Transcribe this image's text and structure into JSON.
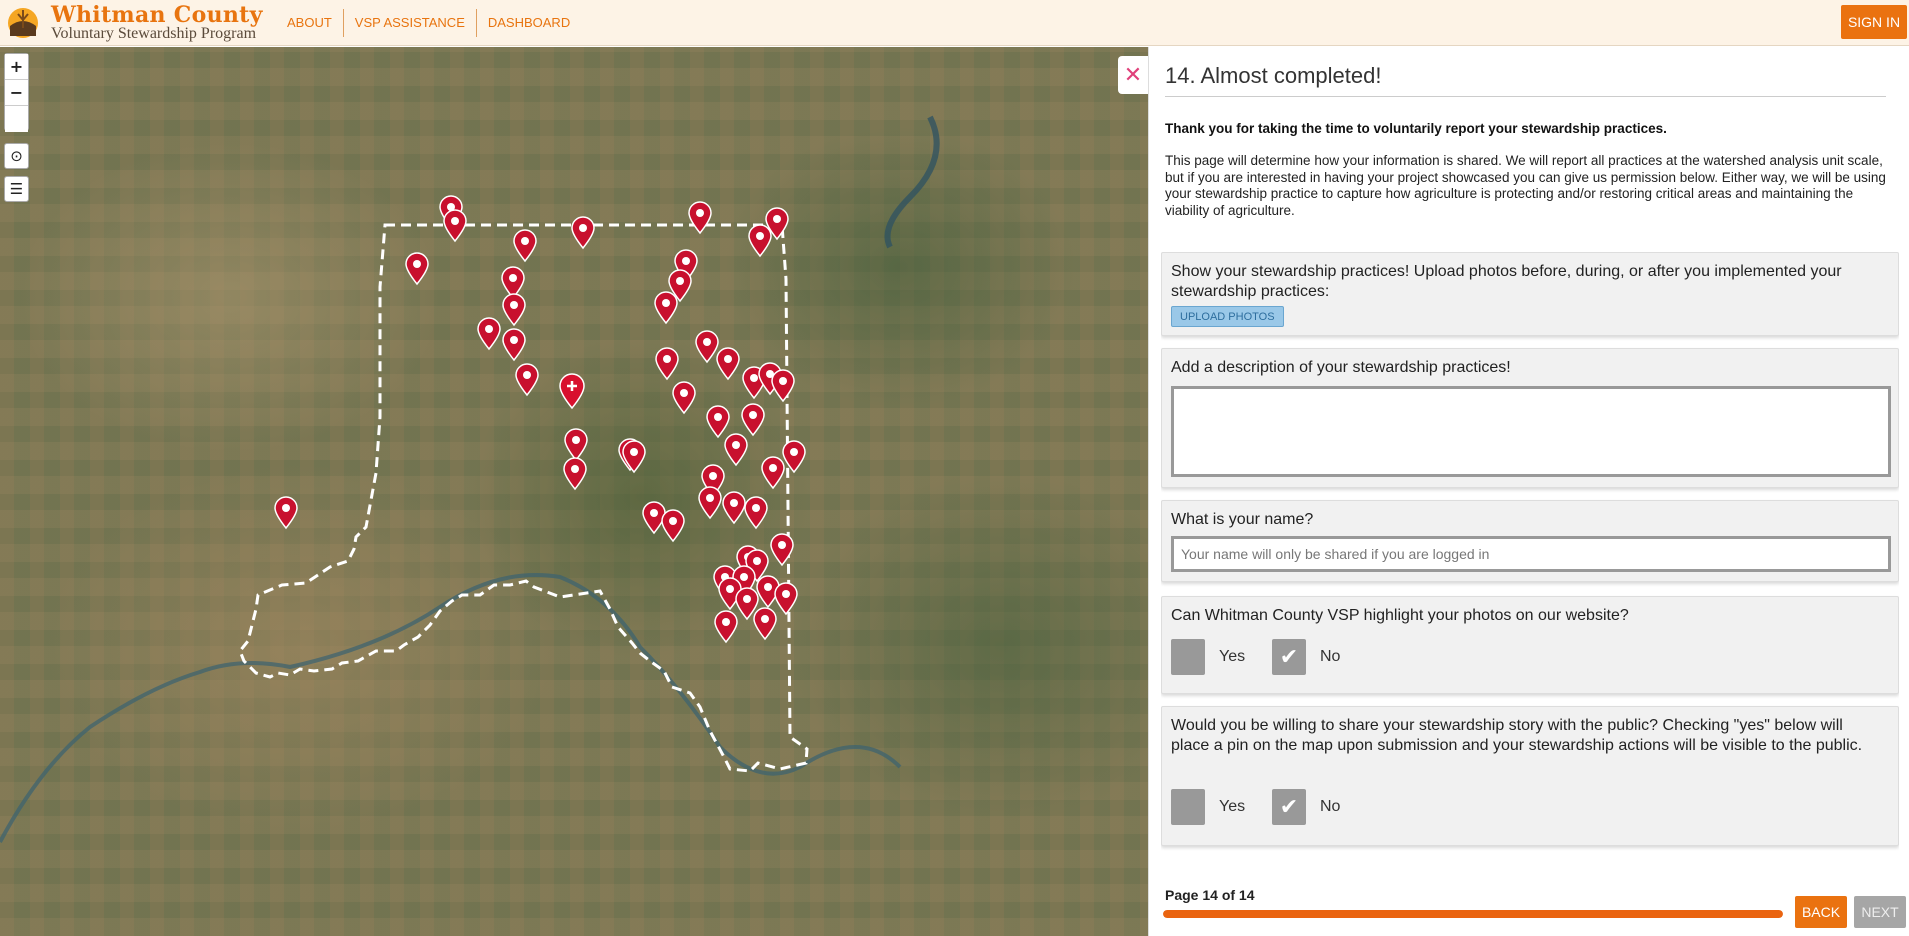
{
  "header": {
    "logo_title": "Whitman County",
    "logo_subtitle": "Voluntary Stewardship Program",
    "nav": [
      {
        "label": "ABOUT"
      },
      {
        "label": "VSP ASSISTANCE"
      },
      {
        "label": "DASHBOARD"
      }
    ],
    "sign_in_label": "SIGN IN"
  },
  "map": {
    "zoom_in_label": "+",
    "zoom_out_label": "−",
    "locate_icon": "crosshair-icon",
    "layers_icon": "layers-icon",
    "marker_icon": "map-pin-icon",
    "new_point_icon": "plus-pin-icon",
    "marker_color": "#c8102e"
  },
  "panel": {
    "close_icon": "close-icon",
    "title": "14. Almost completed!",
    "thanks": "Thank you for taking the time to voluntarily report your stewardship practices.",
    "intro": "This page will determine how your information is shared. We will report all practices at the watershed analysis unit scale, but if you are interested in having your project showcased you can give us permission below. Either way, we will be using your stewardship practice to capture how agriculture is protecting and/or restoring critical areas and maintaining the viability of agriculture.",
    "questions": {
      "photos": {
        "label": "Show your stewardship practices! Upload photos before, during, or after you implemented your stewardship practices:",
        "button": "UPLOAD PHOTOS"
      },
      "description": {
        "label": "Add a description of your stewardship practices!",
        "value": ""
      },
      "name": {
        "label": "What is your name?",
        "value": "",
        "placeholder": "Your name will only be shared if you are logged in"
      },
      "highlight": {
        "label": "Can Whitman County VSP highlight your photos on our website?",
        "yes_label": "Yes",
        "no_label": "No",
        "selected": "No"
      },
      "share_story": {
        "label": "Would you be willing to share your stewardship story with the public? Checking \"yes\" below will place a pin on the map upon submission and your stewardship actions will be visible to the public.",
        "yes_label": "Yes",
        "no_label": "No",
        "selected": "No"
      }
    },
    "check_mark": "✔",
    "page_indicator": "Page 14 of 14",
    "progress": 1.0,
    "back_label": "BACK",
    "next_label": "NEXT"
  },
  "colors": {
    "brand_orange": "#ea7210",
    "progress": "#ea6410",
    "marker": "#c8102e"
  }
}
